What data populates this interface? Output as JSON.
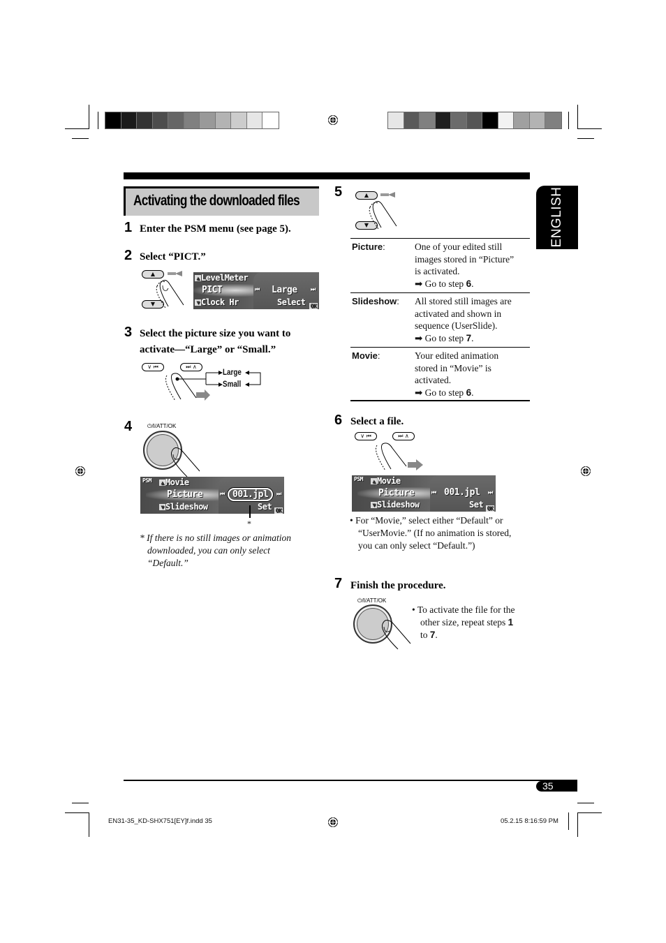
{
  "section_title": "Activating the downloaded files",
  "language_tab": "ENGLISH",
  "page_number": "35",
  "colors": {
    "title_bg": "#c8c8c8",
    "lcd_bg": "#555555",
    "left_colorbar": [
      "#000000",
      "#1a1a1a",
      "#333333",
      "#4d4d4d",
      "#666666",
      "#808080",
      "#999999",
      "#b3b3b3",
      "#cccccc",
      "#e6e6e6",
      "#ffffff"
    ],
    "right_colorbar": [
      "#e6e6e6",
      "#595959",
      "#808080",
      "#1f1f1f",
      "#6b6b6b",
      "#555555",
      "#000000",
      "#f2f2f2",
      "#a0a0a0",
      "#b3b3b3",
      "#808080"
    ]
  },
  "steps": [
    {
      "num": "1",
      "text": "Enter the PSM menu (see page 5)."
    },
    {
      "num": "2",
      "text": "Select “PICT.”",
      "display": {
        "row1": "LevelMeter",
        "row2": "PICT",
        "row3": "Clock Hr",
        "value": "Large",
        "action": "Select",
        "ok": "OK"
      }
    },
    {
      "num": "3",
      "text_line1": "Select the picture size you want to",
      "text_line2": "activate—“Large” or “Small.”",
      "options": [
        "Large",
        "Small"
      ]
    },
    {
      "num": "4",
      "knob_label": "⏻/I/ATT/OK",
      "display": {
        "psm": "PSM",
        "row1": "Movie",
        "row2": "Picture",
        "row3": "Slideshow",
        "value": "001.jpl",
        "action": "Set",
        "ok": "OK"
      },
      "callout": "*",
      "footnote_line1": "* If there is no still images or animation",
      "footnote_line2": "downloaded, you can only select",
      "footnote_line3": "“Default.”"
    },
    {
      "num": "5",
      "table": [
        {
          "term": "Picture",
          "lines": [
            "One of your edited still",
            "images stored in “Picture”",
            "is activated."
          ],
          "goto_prefix": "➡ Go to step ",
          "goto_step": "6"
        },
        {
          "term": "Slideshow",
          "lines": [
            "All stored still images are",
            "activated and shown in",
            "sequence (UserSlide)."
          ],
          "goto_prefix": "➡ Go to step ",
          "goto_step": "7"
        },
        {
          "term": "Movie",
          "lines": [
            "Your edited animation",
            "stored in “Movie” is",
            "activated."
          ],
          "goto_prefix": "➡ Go to step ",
          "goto_step": "6"
        }
      ]
    },
    {
      "num": "6",
      "text": "Select a file.",
      "display": {
        "psm": "PSM",
        "row1": "Movie",
        "row2": "Picture",
        "row3": "Slideshow",
        "value": "001.jpl",
        "action": "Set",
        "ok": "OK"
      },
      "note_line1": "•  For “Movie,” select either “Default” or",
      "note_line2": "“UserMovie.” (If no animation is stored,",
      "note_line3": "you can only select “Default.”)"
    },
    {
      "num": "7",
      "text": "Finish the procedure.",
      "knob_label": "⏻/I/ATT/OK",
      "note_line1": "•  To activate the file for the",
      "note_line2": "other size, repeat steps ",
      "note_step_a": "1",
      "note_line3": "to ",
      "note_step_b": "7"
    }
  ],
  "buttons": {
    "up": "▲",
    "down": "▼",
    "prev": "∨ ⏮",
    "next": "⏭ ∧"
  },
  "slug": {
    "file": "EN31-35_KD-SHX751[EY]f.indd   35",
    "date": "05.2.15   8:16:59 PM"
  }
}
